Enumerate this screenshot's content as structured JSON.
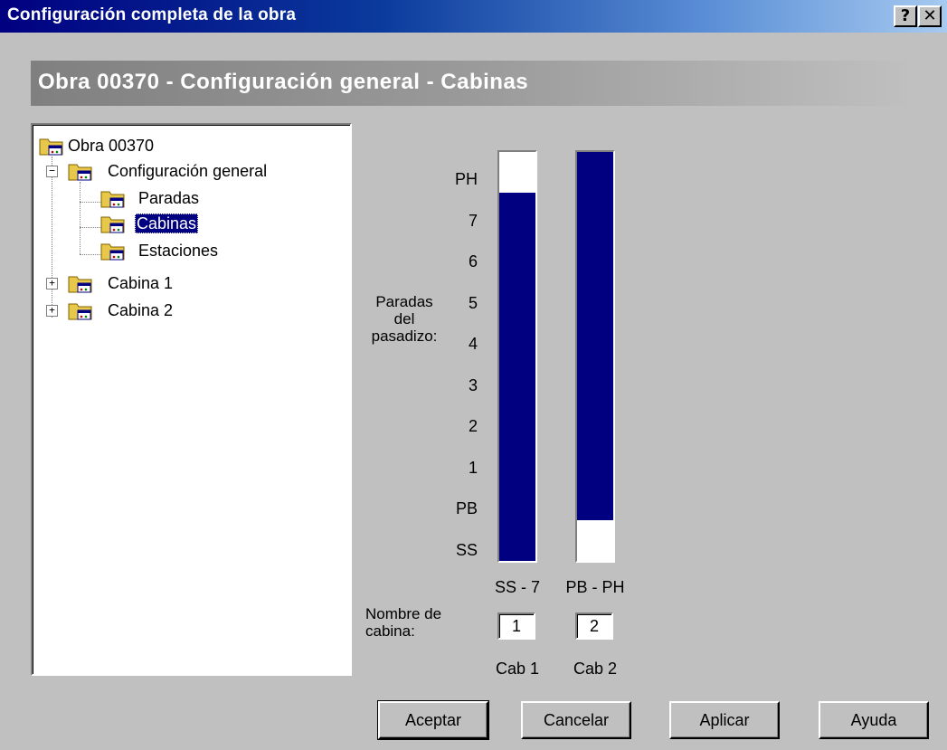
{
  "window": {
    "title": "Configuración completa de la obra",
    "help_glyph": "?",
    "close_glyph": "✕"
  },
  "banner": {
    "text": "Obra 00370 - Configuración general - Cabinas"
  },
  "tree": {
    "nodes": [
      {
        "label": "Obra 00370",
        "icon": "folder-icon"
      },
      {
        "label": "Configuración general",
        "icon": "folder-open-icon",
        "expanded": true
      },
      {
        "label": "Paradas",
        "icon": "folder-icon"
      },
      {
        "label": "Cabinas",
        "icon": "folder-open-icon",
        "selected": true
      },
      {
        "label": "Estaciones",
        "icon": "folder-icon"
      },
      {
        "label": "Cabina 1",
        "icon": "folder-icon",
        "expanded": false
      },
      {
        "label": "Cabina 2",
        "icon": "folder-icon",
        "expanded": false
      }
    ],
    "expand_glyph": "+",
    "collapse_glyph": "−"
  },
  "shaft": {
    "label_line1": "Paradas",
    "label_line2": "del",
    "label_line3": "pasadizo:",
    "floors": [
      "PH",
      "7",
      "6",
      "5",
      "4",
      "3",
      "2",
      "1",
      "PB",
      "SS"
    ],
    "cabins": [
      {
        "range": "SS - 7",
        "name": "1",
        "caption": "Cab 1",
        "from_floor_index": 1,
        "to_floor_index": 9
      },
      {
        "range": "PB - PH",
        "name": "2",
        "caption": "Cab 2",
        "from_floor_index": 0,
        "to_floor_index": 8
      }
    ],
    "fill_color": "#000080",
    "name_label_line1": "Nombre de",
    "name_label_line2": "cabina:"
  },
  "buttons": {
    "accept": "Aceptar",
    "cancel": "Cancelar",
    "apply": "Aplicar",
    "help": "Ayuda"
  }
}
